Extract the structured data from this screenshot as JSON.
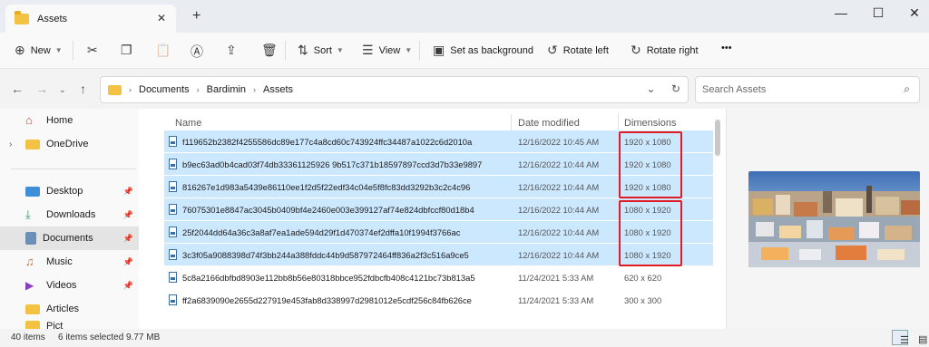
{
  "window": {
    "tab_title": "Assets",
    "new_tab": "+",
    "close_tab": "✕",
    "minimize": "—",
    "maximize": "☐",
    "close": "✕"
  },
  "toolbar": {
    "new_label": "New",
    "sort_label": "Sort",
    "view_label": "View",
    "set_bg_label": "Set as background",
    "rotate_left_label": "Rotate left",
    "rotate_right_label": "Rotate right",
    "more_label": "•••"
  },
  "address": {
    "crumbs": [
      "Documents",
      "Bardimin",
      "Assets"
    ],
    "search_placeholder": "Search Assets"
  },
  "sidebar": {
    "items": [
      {
        "label": "Home",
        "icon": "home-icon"
      },
      {
        "label": "OneDrive",
        "icon": "cloud-folder-icon"
      },
      {
        "label": "Desktop",
        "icon": "desktop-icon"
      },
      {
        "label": "Downloads",
        "icon": "download-icon"
      },
      {
        "label": "Documents",
        "icon": "documents-icon"
      },
      {
        "label": "Music",
        "icon": "music-icon"
      },
      {
        "label": "Videos",
        "icon": "video-icon"
      },
      {
        "label": "Articles",
        "icon": "folder-icon"
      },
      {
        "label": "Pict",
        "icon": "folder-icon"
      }
    ]
  },
  "list": {
    "columns": {
      "name": "Name",
      "date": "Date modified",
      "dimensions": "Dimensions"
    },
    "rows": [
      {
        "name": "f119652b2382f4255586dc89e177c4a8cd60c743924ffc34487a1022c6d2010a",
        "date": "12/16/2022 10:45 AM",
        "dim": "1920 x 1080",
        "selected": true
      },
      {
        "name": "b9ec63ad0b4cad03f74db33361125926 9b517c371b18597897ccd3d7b33e9897",
        "date": "12/16/2022 10:44 AM",
        "dim": "1920 x 1080",
        "selected": true
      },
      {
        "name": "816267e1d983a5439e86110ee1f2d5f22edf34c04e5f8fc83dd3292b3c2c4c96",
        "date": "12/16/2022 10:44 AM",
        "dim": "1920 x 1080",
        "selected": true
      },
      {
        "name": "76075301e8847ac3045b0409bf4e2460e003e399127af74e824dbfccf80d18b4",
        "date": "12/16/2022 10:44 AM",
        "dim": "1080 x 1920",
        "selected": true
      },
      {
        "name": "25f2044dd64a36c3a8af7ea1ade594d29f1d470374ef2dffa10f1994f3766ac",
        "date": "12/16/2022 10:44 AM",
        "dim": "1080 x 1920",
        "selected": true
      },
      {
        "name": "3c3f05a9088398d74f3bb244a388fddc44b9d587972464ff836a2f3c516a9ce5",
        "date": "12/16/2022 10:44 AM",
        "dim": "1080 x 1920",
        "selected": true
      },
      {
        "name": "5c8a2166dbfbd8903e112bb8b56e80318bbce952fdbcfb408c4121bc73b813a5",
        "date": "11/24/2021 5:33 AM",
        "dim": "620 x 620",
        "selected": false
      },
      {
        "name": "ff2a6839090e2655d227919e453fab8d338997d2981012e5cdf256c84fb626ce",
        "date": "11/24/2021 5:33 AM",
        "dim": "300 x 300",
        "selected": false
      }
    ]
  },
  "status": {
    "items": "40 items",
    "selected": "6 items selected",
    "size": "9.77 MB"
  },
  "colors": {
    "selection": "#cce8ff",
    "highlight": "#e01b24",
    "folder": "#f4c242"
  }
}
